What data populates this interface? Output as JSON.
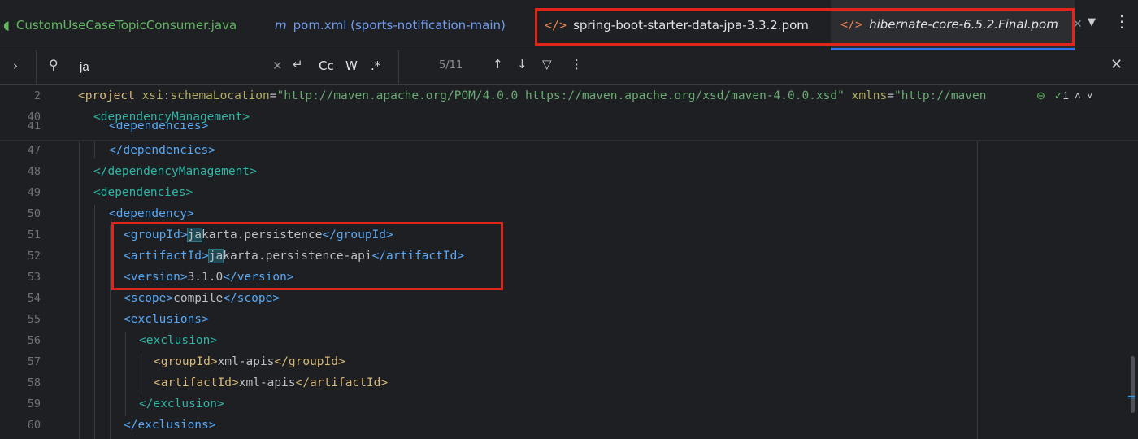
{
  "tabs": [
    {
      "label": "CustomUseCaseTopicConsumer.java",
      "icon": "java-class-icon"
    },
    {
      "label": "pom.xml (sports-notification-main)",
      "icon": "maven-icon",
      "icon_glyph": "m"
    },
    {
      "label": "spring-boot-starter-data-jpa-3.3.2.pom",
      "icon": "xml-file-icon",
      "icon_glyph": "</>"
    },
    {
      "label": "hibernate-core-6.5.2.Final.pom",
      "icon": "xml-file-icon",
      "icon_glyph": "</>",
      "active": true
    }
  ],
  "search": {
    "query": "ja",
    "match_count": "5/11",
    "case_label": "Cc",
    "word_label": "W",
    "regex_label": ".*"
  },
  "editor": {
    "inspection_count": "1",
    "lines": [
      {
        "no": "2",
        "text": "<project xsi:schemaLocation=\"http://maven.apache.org/POM/4.0.0 https://maven.apache.org/xsd/maven-4.0.0.xsd\" xmlns=\"http://maven"
      },
      {
        "no": "40",
        "text": "<dependencyManagement>"
      },
      {
        "no": "41",
        "text": "<dependencies>"
      },
      {
        "no": "47",
        "text": "</dependencies>"
      },
      {
        "no": "48",
        "text": "</dependencyManagement>"
      },
      {
        "no": "49",
        "text": "<dependencies>"
      },
      {
        "no": "50",
        "text": "<dependency>"
      },
      {
        "no": "51",
        "text": "<groupId>jakarta.persistence</groupId>"
      },
      {
        "no": "52",
        "text": "<artifactId>jakarta.persistence-api</artifactId>"
      },
      {
        "no": "53",
        "text": "<version>3.1.0</version>"
      },
      {
        "no": "54",
        "text": "<scope>compile</scope>"
      },
      {
        "no": "55",
        "text": "<exclusions>"
      },
      {
        "no": "56",
        "text": "<exclusion>"
      },
      {
        "no": "57",
        "text": "<groupId>xml-apis</groupId>"
      },
      {
        "no": "58",
        "text": "<artifactId>xml-apis</artifactId>"
      },
      {
        "no": "59",
        "text": "</exclusion>"
      },
      {
        "no": "60",
        "text": "</exclusions>"
      }
    ]
  },
  "colors": {
    "highlight": "#e0261b",
    "tag_gold": "#d5b778",
    "tag_blue": "#57a8f5",
    "tag_teal": "#2fb5a6",
    "attr_value": "#6aab73",
    "search_hit": "#1f4b57"
  }
}
